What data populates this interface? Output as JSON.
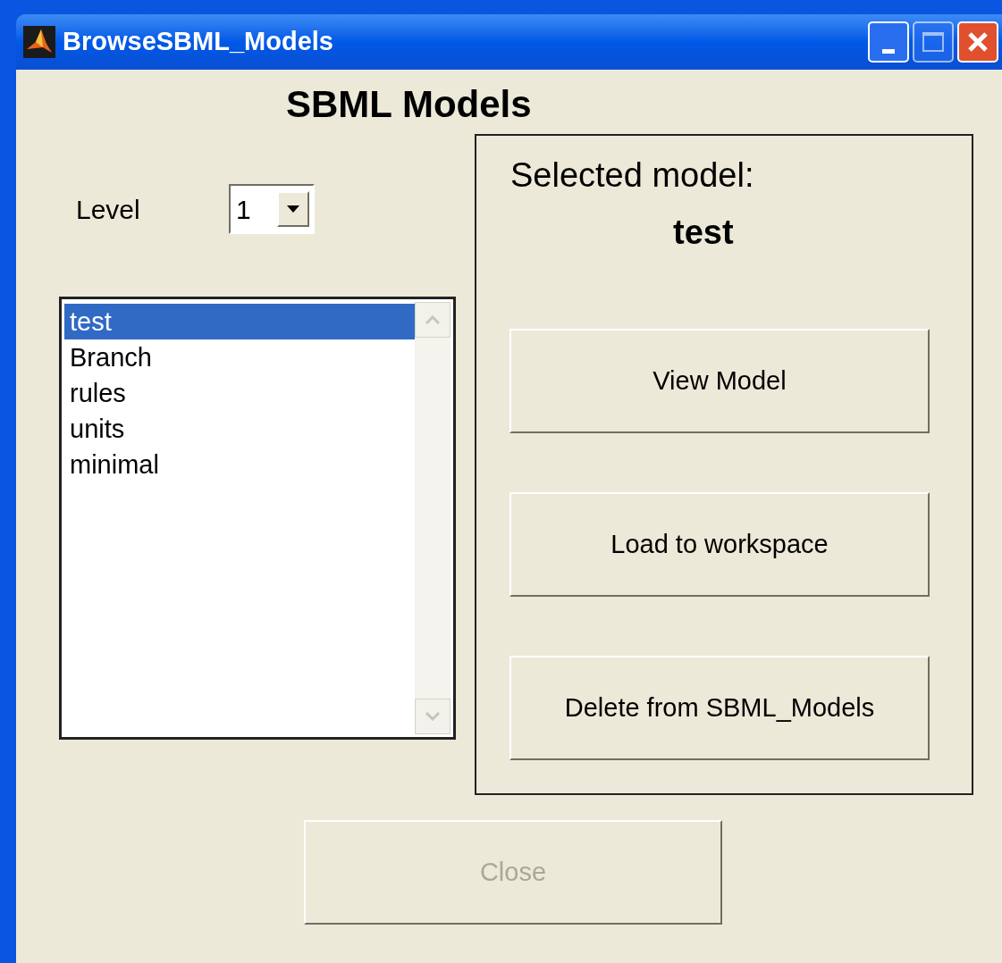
{
  "window": {
    "title": "BrowseSBML_Models"
  },
  "heading": "SBML Models",
  "level_field": {
    "label": "Level",
    "value": "1"
  },
  "models_list": {
    "items": [
      {
        "label": "test",
        "selected": true
      },
      {
        "label": "Branch",
        "selected": false
      },
      {
        "label": "rules",
        "selected": false
      },
      {
        "label": "units",
        "selected": false
      },
      {
        "label": "minimal",
        "selected": false
      }
    ]
  },
  "selected_panel": {
    "label": "Selected model:",
    "model": "test",
    "buttons": [
      {
        "label": "View Model",
        "disabled": false
      },
      {
        "label": "Load to workspace",
        "disabled": false
      },
      {
        "label": "Delete from SBML_Models",
        "disabled": false
      }
    ]
  },
  "close_button": {
    "label": "Close",
    "disabled": true
  }
}
